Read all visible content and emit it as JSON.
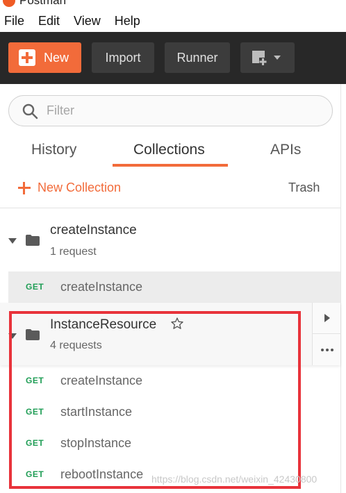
{
  "app": {
    "title": "Postman"
  },
  "menu": [
    "File",
    "Edit",
    "View",
    "Help"
  ],
  "toolbar": {
    "new_label": "New",
    "import_label": "Import",
    "runner_label": "Runner",
    "workspace_icon": "new-window-icon"
  },
  "search": {
    "placeholder": "Filter",
    "value": ""
  },
  "tabs": [
    {
      "label": "History",
      "active": false
    },
    {
      "label": "Collections",
      "active": true
    },
    {
      "label": "APIs",
      "active": false
    }
  ],
  "actions": {
    "new_collection": "New Collection",
    "trash": "Trash"
  },
  "collections": [
    {
      "name": "createInstance",
      "count": "1 request",
      "requests": [
        {
          "method": "GET",
          "name": "createInstance",
          "selected": true
        }
      ]
    },
    {
      "name": "InstanceResource",
      "count": "4 requests",
      "starred": false,
      "requests": [
        {
          "method": "GET",
          "name": "createInstance"
        },
        {
          "method": "GET",
          "name": "startInstance"
        },
        {
          "method": "GET",
          "name": "stopInstance"
        },
        {
          "method": "GET",
          "name": "rebootInstance"
        }
      ]
    }
  ],
  "watermark": "https://blog.csdn.net/weixin_42430800",
  "colors": {
    "accent": "#f26b3a",
    "toolbar_bg": "#282828",
    "get_method": "#1f9d55",
    "annotation_box": "#e8333b"
  }
}
